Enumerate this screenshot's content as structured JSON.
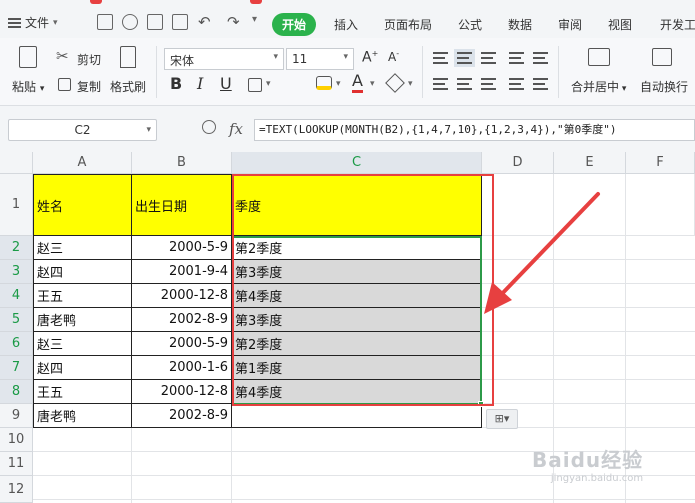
{
  "menu": {
    "file_label": "文件",
    "tabs": [
      "开始",
      "插入",
      "页面布局",
      "公式",
      "数据",
      "审阅",
      "视图",
      "开发工"
    ]
  },
  "ribbon": {
    "paste": "粘贴",
    "cut": "剪切",
    "copy": "复制",
    "format_painter": "格式刷",
    "font_name": "宋体",
    "font_size": "11",
    "bold": "B",
    "italic": "I",
    "underline": "U",
    "font_up": "A",
    "font_down": "A",
    "font_color": "A",
    "merge_center": "合并居中",
    "wrap_text": "自动换行"
  },
  "formula_bar": {
    "name_box": "C2",
    "fx": "fx",
    "formula": "=TEXT(LOOKUP(MONTH(B2),{1,4,7,10},{1,2,3,4}),\"第0季度\")"
  },
  "sheet": {
    "columns": [
      "A",
      "B",
      "C",
      "D",
      "E",
      "F"
    ],
    "row_numbers": [
      "1",
      "2",
      "3",
      "4",
      "5",
      "6",
      "7",
      "8",
      "9",
      "10",
      "11",
      "12"
    ],
    "header": {
      "a": "姓名",
      "b": "出生日期",
      "c": "季度"
    },
    "rows": [
      {
        "a": "赵三",
        "b": "2000-5-9",
        "c": "第2季度"
      },
      {
        "a": "赵四",
        "b": "2001-9-4",
        "c": "第3季度"
      },
      {
        "a": "王五",
        "b": "2000-12-8",
        "c": "第4季度"
      },
      {
        "a": "唐老鸭",
        "b": "2002-8-9",
        "c": "第3季度"
      },
      {
        "a": "赵三",
        "b": "2000-5-9",
        "c": "第2季度"
      },
      {
        "a": "赵四",
        "b": "2000-1-6",
        "c": "第1季度"
      },
      {
        "a": "王五",
        "b": "2000-12-8",
        "c": "第4季度"
      },
      {
        "a": "唐老鸭",
        "b": "2002-8-9",
        "c": ""
      }
    ]
  },
  "colors": {
    "header_fill": "#ffff00",
    "selection_fill": "#d9d9d9",
    "annotation_red": "#e74040",
    "selection_green": "#2c9a48",
    "active_tab": "#2bb24c"
  },
  "icons": [
    "menu-icon",
    "save-icon",
    "undo-icon",
    "redo-icon",
    "print-icon",
    "cut-icon",
    "copy-icon",
    "format-painter-icon",
    "zoom-icon",
    "paste-options-icon",
    "red-arrow-annotation"
  ]
}
